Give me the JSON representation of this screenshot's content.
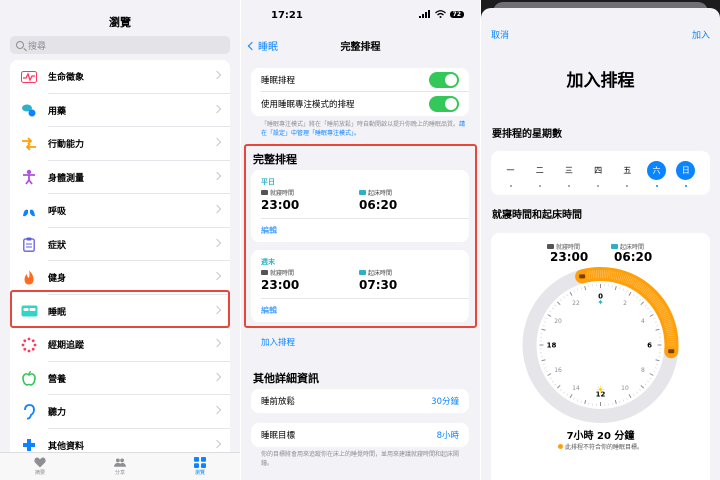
{
  "browse": {
    "title": "瀏覽",
    "search_placeholder": "搜尋",
    "items": [
      {
        "label": "生命徵象",
        "icon": "vitals-icon",
        "color": "#ff375f"
      },
      {
        "label": "用藥",
        "icon": "pills-icon",
        "color": "#30b0c7"
      },
      {
        "label": "行動能力",
        "icon": "mobility-icon",
        "color": "#ff9f0a"
      },
      {
        "label": "身體測量",
        "icon": "body-measurement-icon",
        "color": "#af52de"
      },
      {
        "label": "呼吸",
        "icon": "lungs-icon",
        "color": "#0a84ff"
      },
      {
        "label": "症狀",
        "icon": "clipboard-icon",
        "color": "#5e5ce6"
      },
      {
        "label": "健身",
        "icon": "flame-icon",
        "color": "#ff6b22"
      },
      {
        "label": "睡眠",
        "icon": "bed-icon",
        "color": "#30d5c8"
      },
      {
        "label": "經期追蹤",
        "icon": "cycle-icon",
        "color": "#ff375f"
      },
      {
        "label": "營養",
        "icon": "apple-icon",
        "color": "#34c759"
      },
      {
        "label": "聽力",
        "icon": "ear-icon",
        "color": "#0a84ff"
      },
      {
        "label": "其他資料",
        "icon": "plus-icon",
        "color": "#0a84ff"
      }
    ],
    "tabs": [
      {
        "label": "摘要",
        "icon": "heart-icon"
      },
      {
        "label": "分享",
        "icon": "people-icon"
      },
      {
        "label": "瀏覽",
        "icon": "grid-icon"
      }
    ]
  },
  "schedule": {
    "status_time": "17:21",
    "battery": "72",
    "back_label": "睡眠",
    "title": "完整排程",
    "toggle1_label": "睡眠排程",
    "toggle2_label": "使用睡眠專注模式的排程",
    "footnote_prefix": "「睡眠專注模式」將在「睡前放鬆」時自動開啟以提升你晚上的睡眠品質。",
    "footnote_link": "請在「設定」中管理「睡眠專注模式」。",
    "section_title": "完整排程",
    "weekday": {
      "day": "平日",
      "bed_label": "就寢時間",
      "wake_label": "起床時間",
      "bed": "23:00",
      "wake": "06:20",
      "edit": "編輯"
    },
    "weekend": {
      "day": "週末",
      "bed_label": "就寢時間",
      "wake_label": "起床時間",
      "bed": "23:00",
      "wake": "07:30",
      "edit": "編輯"
    },
    "add_schedule": "加入排程",
    "more_title": "其他詳細資訊",
    "wind_down_label": "睡前放鬆",
    "wind_down_value": "30分鐘",
    "goal_label": "睡眠目標",
    "goal_value": "8小時",
    "goal_note": "你的目標將會用來追蹤你在床上的睡覺時間，並用來建議就寢時間和起床鬧鐘。"
  },
  "add_sheet": {
    "cancel": "取消",
    "add": "加入",
    "title": "加入排程",
    "days_title": "要排程的星期數",
    "days": [
      "一",
      "二",
      "三",
      "四",
      "五",
      "六",
      "日"
    ],
    "days_selected": [
      "六",
      "日"
    ],
    "time_title": "就寢時間和起床時間",
    "bed_label": "就寢時間",
    "wake_label": "起床時間",
    "bed": "23:00",
    "wake": "06:20",
    "clock_numbers": [
      "0",
      "2",
      "4",
      "6",
      "8",
      "10",
      "12",
      "14",
      "16",
      "18",
      "20",
      "22"
    ],
    "duration": "7小時 20 分鐘",
    "warning": "此排程不符合你的睡眠目標。",
    "accent": "#ff9f0a"
  }
}
